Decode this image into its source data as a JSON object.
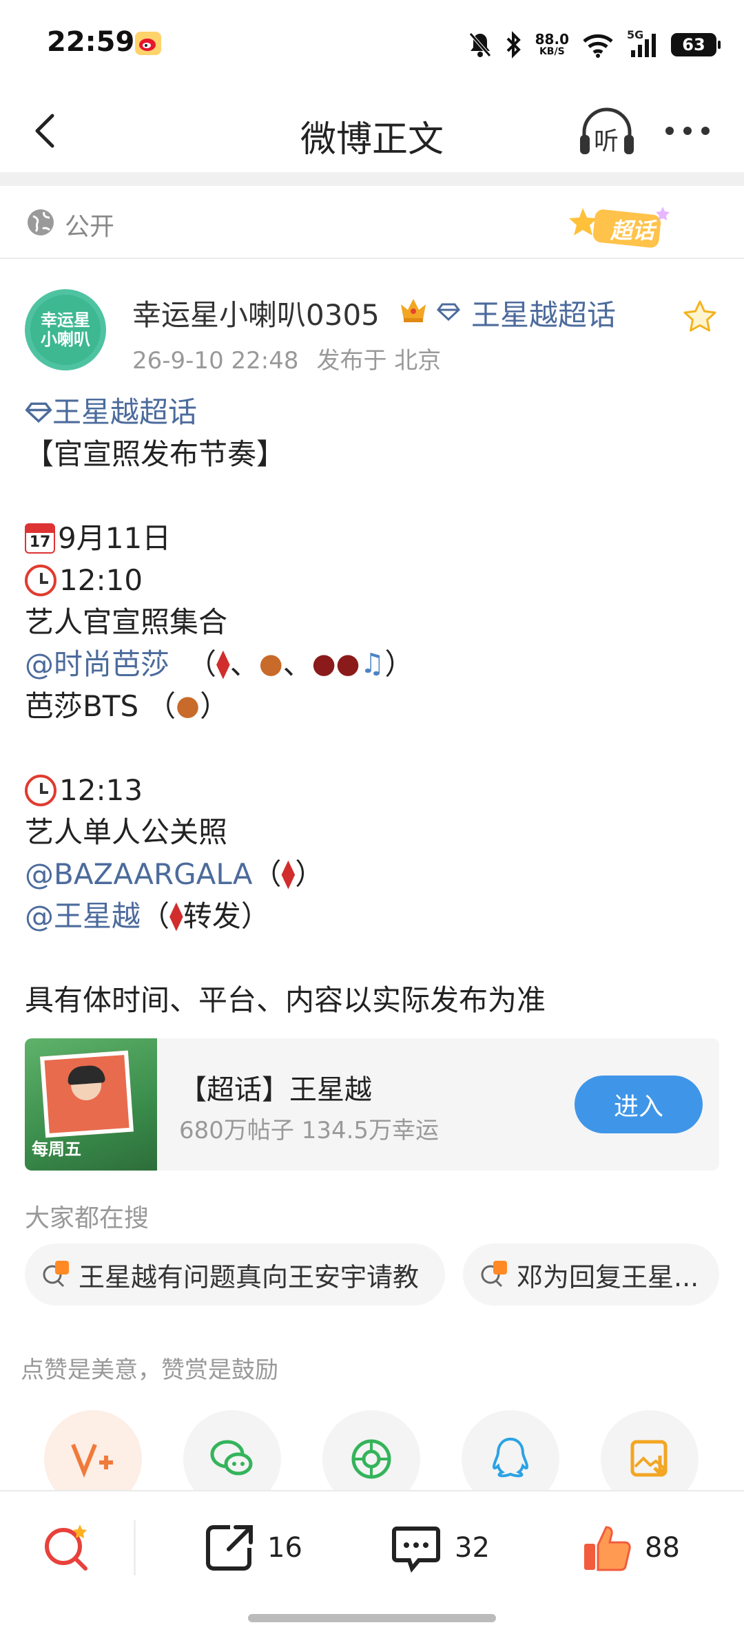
{
  "status_bar": {
    "time": "22:59",
    "net_speed": "88.0",
    "net_unit": "KB/S",
    "network": "5G",
    "battery": "63",
    "icons": [
      "weibo-notification-icon",
      "mute-icon",
      "bluetooth-icon",
      "wifi-icon",
      "signal-icon",
      "battery-icon"
    ]
  },
  "nav": {
    "title": "微博正文",
    "listen_label": "听"
  },
  "visibility": {
    "label": "公开",
    "badge": "超话"
  },
  "author": {
    "avatar_text": [
      "幸运星",
      "小喇叭"
    ],
    "name": "幸运星小喇叭0305",
    "topic": "王星越超话",
    "time": "26-9-10 22:48",
    "location": "发布于 北京"
  },
  "post": {
    "topic_tag": "王星越超话",
    "headline": "【官宣照发布节奏】",
    "cal_label": "17",
    "date": "9月11日",
    "time1": "12:10",
    "item1": "艺人官宣照集合",
    "mention1": "@时尚芭莎",
    "bts": "芭莎BTS",
    "time2": "12:13",
    "item2": "艺人单人公关照",
    "mention2": "@BAZAARGALA",
    "mention3": "@王星越",
    "repost": "转发",
    "footer": "具有体时间、平台、内容以实际发布为准"
  },
  "topic_card": {
    "title": "【超话】王星越",
    "stats": "680万帖子 134.5万幸运",
    "button": "进入",
    "thumb_text": "每周五"
  },
  "searches": {
    "heading": "大家都在搜",
    "items": [
      "王星越有问题真向王安宇请教",
      "邓为回复王星..."
    ]
  },
  "reward": {
    "hint": "点赞是美意，赞赏是鼓励",
    "share_targets": [
      "v-plus-reward-icon",
      "wechat-icon",
      "moments-icon",
      "qq-icon",
      "save-image-icon"
    ]
  },
  "bottom_bar": {
    "repost_count": "16",
    "comment_count": "32",
    "like_count": "88"
  },
  "colors": {
    "link": "#4c6b9c",
    "button": "#3f96e8",
    "accent_orange": "#f07a3a"
  }
}
